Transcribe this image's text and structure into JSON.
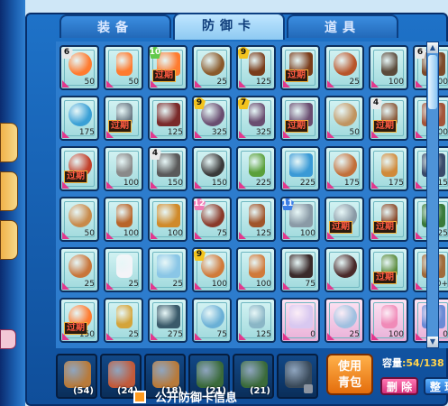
{
  "tabs": [
    {
      "label": "装备",
      "active": false
    },
    {
      "label": "防御卡",
      "active": true
    },
    {
      "label": "道具",
      "active": false
    }
  ],
  "badge_colors": {
    "gray": "#e9e9e9",
    "green": "#62c94b",
    "yellow": "#f3c31e",
    "pink": "#f07ab4",
    "blue": "#3b7ee7"
  },
  "expired_label": "过期",
  "cards": [
    {
      "cost": "50",
      "icon": "fire-icon",
      "badge": "6",
      "badge_color": "gray",
      "expired": false,
      "color": "#ff7b2f"
    },
    {
      "cost": "50",
      "icon": "fire-icon",
      "badge": "",
      "badge_color": "",
      "expired": false,
      "color": "#ff7b2f"
    },
    {
      "cost": "",
      "icon": "fire-icon",
      "badge": "10",
      "badge_color": "green",
      "expired": true,
      "color": "#ff7b2f"
    },
    {
      "cost": "25",
      "icon": "bag-icon",
      "badge": "",
      "badge_color": "",
      "expired": false,
      "color": "#8a5a2b"
    },
    {
      "cost": "125",
      "icon": "bottle-icon",
      "badge": "9",
      "badge_color": "yellow",
      "expired": false,
      "color": "#7a3c1a"
    },
    {
      "cost": "",
      "icon": "bottle-icon",
      "badge": "",
      "badge_color": "",
      "expired": true,
      "color": "#7a3c1a"
    },
    {
      "cost": "25",
      "icon": "skewer-icon",
      "badge": "",
      "badge_color": "",
      "expired": false,
      "color": "#b8552a"
    },
    {
      "cost": "100",
      "icon": "crate-icon",
      "badge": "",
      "badge_color": "",
      "expired": false,
      "color": "#5a4a3a"
    },
    {
      "cost": "200",
      "icon": "cannon-icon",
      "badge": "6",
      "badge_color": "gray",
      "expired": false,
      "color": "#7d4a2a"
    },
    {
      "cost": "175",
      "icon": "ice-cannon-icon",
      "badge": "",
      "badge_color": "",
      "expired": false,
      "color": "#3aa0d6"
    },
    {
      "cost": "",
      "icon": "lamp-icon",
      "badge": "",
      "badge_color": "",
      "expired": true,
      "color": "#6b7a85"
    },
    {
      "cost": "125",
      "icon": "robot-icon",
      "badge": "",
      "badge_color": "",
      "expired": false,
      "color": "#7a2a2a"
    },
    {
      "cost": "325",
      "icon": "cart-icon",
      "badge": "9",
      "badge_color": "yellow",
      "expired": false,
      "color": "#6a4d70"
    },
    {
      "cost": "325",
      "icon": "cart-icon",
      "badge": "7",
      "badge_color": "yellow",
      "expired": false,
      "color": "#6a4d70"
    },
    {
      "cost": "",
      "icon": "cart-icon",
      "badge": "",
      "badge_color": "",
      "expired": true,
      "color": "#6a4d70"
    },
    {
      "cost": "50",
      "icon": "sack-icon",
      "badge": "",
      "badge_color": "",
      "expired": false,
      "color": "#c09460"
    },
    {
      "cost": "",
      "icon": "turret-icon",
      "badge": "4",
      "badge_color": "gray",
      "expired": true,
      "color": "#8a5a3a"
    },
    {
      "cost": "100",
      "icon": "barrel-icon",
      "badge": "",
      "badge_color": "",
      "expired": false,
      "color": "#a4553a"
    },
    {
      "cost": "",
      "icon": "sausage-icon",
      "badge": "",
      "badge_color": "",
      "expired": true,
      "color": "#c2402a"
    },
    {
      "cost": "100",
      "icon": "whisk-icon",
      "badge": "",
      "badge_color": "",
      "expired": false,
      "color": "#8a8a8a"
    },
    {
      "cost": "150",
      "icon": "skull-icon",
      "badge": "4",
      "badge_color": "gray",
      "expired": false,
      "color": "#5a5a5a"
    },
    {
      "cost": "150",
      "icon": "stove-icon",
      "badge": "",
      "badge_color": "",
      "expired": false,
      "color": "#3a3a3a"
    },
    {
      "cost": "225",
      "icon": "juice-icon",
      "badge": "",
      "badge_color": "",
      "expired": false,
      "color": "#5aa03a"
    },
    {
      "cost": "225",
      "icon": "fountain-icon",
      "badge": "",
      "badge_color": "",
      "expired": false,
      "color": "#3a9ad6"
    },
    {
      "cost": "175",
      "icon": "cake-icon",
      "badge": "",
      "badge_color": "",
      "expired": false,
      "color": "#c2703a"
    },
    {
      "cost": "175",
      "icon": "pot-icon",
      "badge": "",
      "badge_color": "",
      "expired": false,
      "color": "#d08a3a"
    },
    {
      "cost": "115",
      "icon": "penguin-icon",
      "badge": "",
      "badge_color": "",
      "expired": false,
      "color": "#3a4a6a"
    },
    {
      "cost": "50",
      "icon": "toast-icon",
      "badge": "",
      "badge_color": "",
      "expired": false,
      "color": "#c88a4a"
    },
    {
      "cost": "100",
      "icon": "squirrel-icon",
      "badge": "",
      "badge_color": "",
      "expired": false,
      "color": "#b8652a"
    },
    {
      "cost": "100",
      "icon": "fish-plate-icon",
      "badge": "",
      "badge_color": "",
      "expired": false,
      "color": "#d08a2a"
    },
    {
      "cost": "75",
      "icon": "grill-icon",
      "badge": "12",
      "badge_color": "pink",
      "expired": false,
      "color": "#8a3a2a"
    },
    {
      "cost": "125",
      "icon": "pie-icon",
      "badge": "",
      "badge_color": "",
      "expired": false,
      "color": "#a0552a"
    },
    {
      "cost": "100",
      "icon": "mouse-icon",
      "badge": "11",
      "badge_color": "blue",
      "expired": false,
      "color": "#8a9aa6"
    },
    {
      "cost": "",
      "icon": "mouse-icon",
      "badge": "",
      "badge_color": "",
      "expired": true,
      "color": "#8a9aa6"
    },
    {
      "cost": "",
      "icon": "nut-icon",
      "badge": "",
      "badge_color": "",
      "expired": true,
      "color": "#8a4a2a"
    },
    {
      "cost": "125",
      "icon": "bowl-icon",
      "badge": "",
      "badge_color": "",
      "expired": false,
      "color": "#3a7a3a"
    },
    {
      "cost": "25",
      "icon": "dish-icon",
      "badge": "",
      "badge_color": "",
      "expired": false,
      "color": "#c8753a"
    },
    {
      "cost": "25",
      "icon": "cloud-icon",
      "badge": "",
      "badge_color": "",
      "expired": false,
      "color": "#f4f4f8"
    },
    {
      "cost": "25",
      "icon": "bubble-icon",
      "badge": "",
      "badge_color": "",
      "expired": false,
      "color": "#8ac6e6"
    },
    {
      "cost": "100",
      "icon": "parfait-icon",
      "badge": "9",
      "badge_color": "yellow",
      "expired": false,
      "color": "#d07a3a"
    },
    {
      "cost": "100",
      "icon": "parfait-icon",
      "badge": "",
      "badge_color": "",
      "expired": false,
      "color": "#d07a3a"
    },
    {
      "cost": "75",
      "icon": "pipe-icon",
      "badge": "",
      "badge_color": "",
      "expired": false,
      "color": "#3a2a2a"
    },
    {
      "cost": "",
      "icon": "coal-icon",
      "badge": "",
      "badge_color": "",
      "expired": false,
      "color": "#4a2a2a"
    },
    {
      "cost": "",
      "icon": "lantern-icon",
      "badge": "",
      "badge_color": "",
      "expired": true,
      "color": "#5a8a3a"
    },
    {
      "cost": "300+",
      "icon": "cookie-icon",
      "badge": "",
      "badge_color": "",
      "expired": false,
      "color": "#a06a3a"
    },
    {
      "cost": "150",
      "icon": "fire-icon",
      "badge": "",
      "badge_color": "",
      "expired": true,
      "color": "#ff7b2f"
    },
    {
      "cost": "25",
      "icon": "candle-icon",
      "badge": "",
      "badge_color": "",
      "expired": false,
      "color": "#d4a43a"
    },
    {
      "cost": "275",
      "icon": "fish-icon",
      "badge": "",
      "badge_color": "",
      "expired": false,
      "color": "#3a5a6a"
    },
    {
      "cost": "75",
      "icon": "ice-bucket-icon",
      "badge": "",
      "badge_color": "",
      "expired": false,
      "color": "#6ab0d6"
    },
    {
      "cost": "125",
      "icon": "jar-icon",
      "badge": "",
      "badge_color": "",
      "expired": false,
      "color": "#8ab6c6"
    },
    {
      "cost": "0",
      "icon": "teacup-icon",
      "badge": "",
      "badge_color": "",
      "expired": false,
      "color": "#d8c8f0",
      "pink": true
    },
    {
      "cost": "25",
      "icon": "oil-lamp-icon",
      "badge": "",
      "badge_color": "",
      "expired": false,
      "color": "#a0c0e0",
      "pink": true
    },
    {
      "cost": "100",
      "icon": "cake-slice-icon",
      "badge": "",
      "badge_color": "",
      "expired": false,
      "color": "#f08ab8",
      "pink": true
    },
    {
      "cost": "0",
      "icon": "cup-cat-icon",
      "badge": "",
      "badge_color": "",
      "expired": false,
      "color": "#6a8ad6",
      "pink": true
    }
  ],
  "decks": [
    {
      "count": "(54)",
      "icon": "bag-icon",
      "color": "#b87a3a"
    },
    {
      "count": "(24)",
      "icon": "cake-icon",
      "color": "#c25a3a"
    },
    {
      "count": "(18)",
      "icon": "basket-icon",
      "color": "#b87a3a"
    },
    {
      "count": "(21)",
      "icon": "pot-icon",
      "color": "#3a6a3a"
    },
    {
      "count": "(21)",
      "icon": "pot-icon",
      "color": "#3a6a3a"
    },
    {
      "count": "",
      "icon": "locked-icon",
      "color": "#3a4a5a"
    }
  ],
  "use_button": {
    "line1": "使用",
    "line2": "青包"
  },
  "capacity": {
    "label": "容量",
    "value": ":54/138"
  },
  "delete_label": "删 除",
  "tidy_label": "整 理",
  "public_label": "公开防御卡信息"
}
